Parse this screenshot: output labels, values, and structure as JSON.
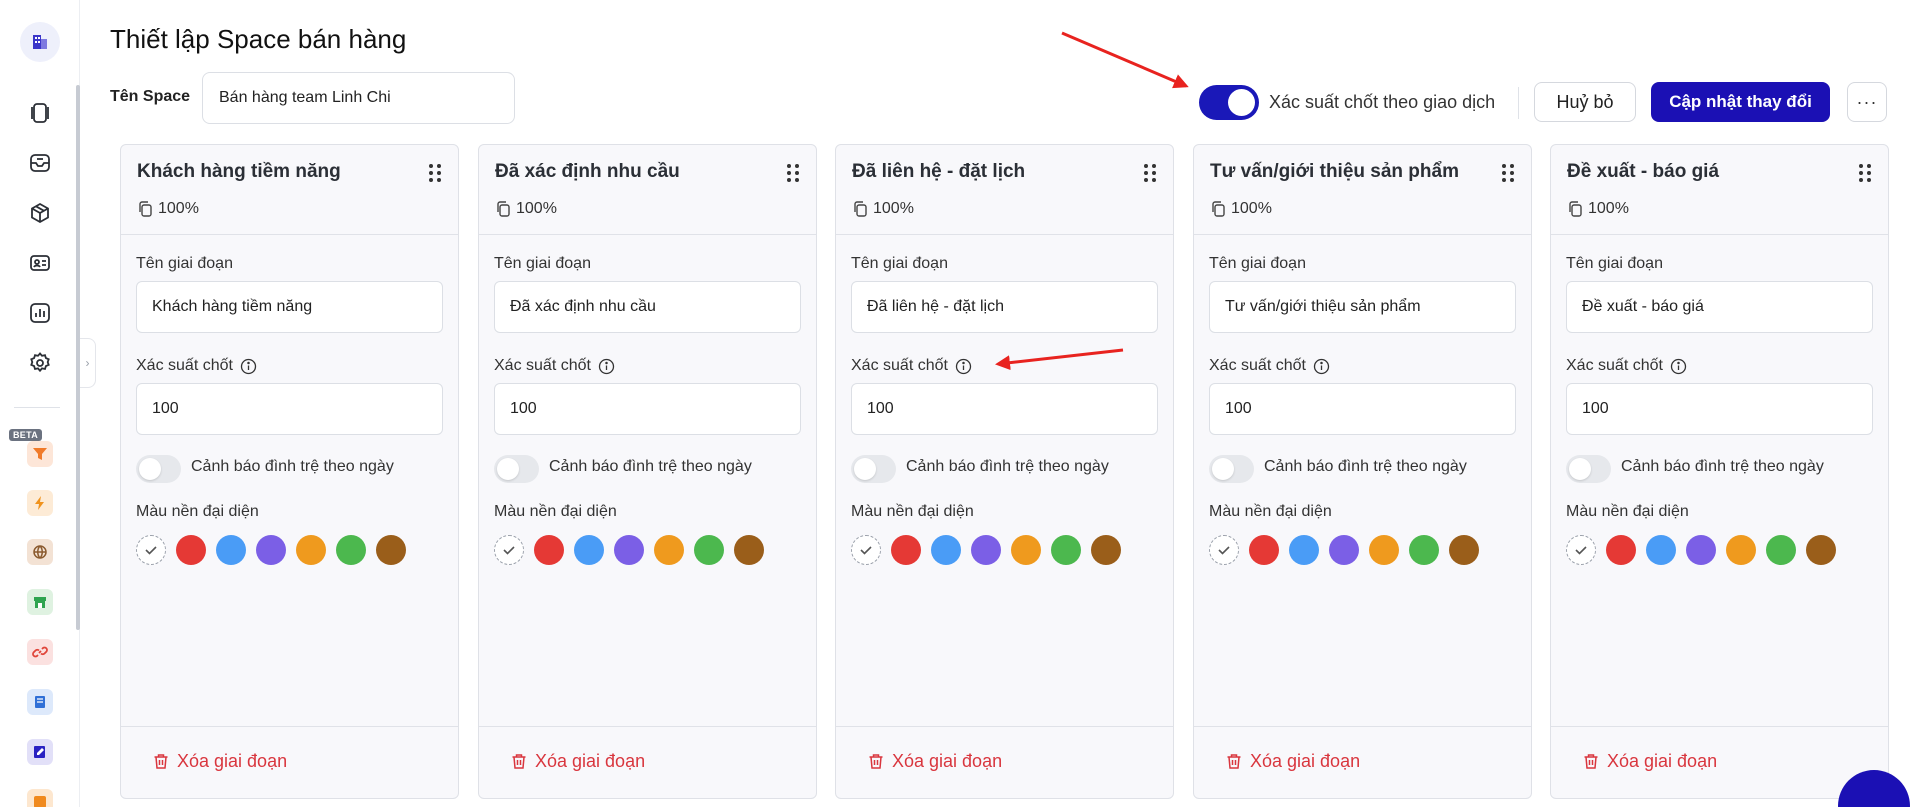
{
  "page": {
    "title": "Thiết lập Space bán hàng",
    "space_label": "Tên Space",
    "space_name": "Bán hàng team Linh Chi"
  },
  "header": {
    "toggle_label": "Xác suất chốt theo giao dịch",
    "toggle_on": true,
    "cancel_label": "Huỷ bỏ",
    "update_label": "Cập nhật thay đổi",
    "more_label": "···"
  },
  "sidebar": {
    "beta_label": "BETA",
    "collapse_glyph": "›"
  },
  "stage_field_labels": {
    "name": "Tên giai đoạn",
    "probability": "Xác suất chốt",
    "stagnation_warning": "Cảnh báo đình trệ theo ngày",
    "color": "Màu nền đại diện",
    "delete": "Xóa giai đoạn"
  },
  "swatch_colors": [
    "#e53935",
    "#4a9cf6",
    "#7b5fe6",
    "#ef9a1e",
    "#4cb84e",
    "#9a5e1a"
  ],
  "stages": [
    {
      "title": "Khách hàng tiềm năng",
      "percent": "100%",
      "name": "Khách hàng tiềm năng",
      "probability": "100",
      "stagnation_warning": false
    },
    {
      "title": "Đã xác định nhu cầu",
      "percent": "100%",
      "name": "Đã xác định nhu cầu",
      "probability": "100",
      "stagnation_warning": false
    },
    {
      "title": "Đã liên hệ - đặt lịch",
      "percent": "100%",
      "name": "Đã liên hệ - đặt lịch",
      "probability": "100",
      "stagnation_warning": false
    },
    {
      "title": "Tư vấn/giới thiệu sản phẩm",
      "percent": "100%",
      "name": "Tư vấn/giới thiệu sản phẩm",
      "probability": "100",
      "stagnation_warning": false
    },
    {
      "title": "Đề xuất - báo giá",
      "percent": "100%",
      "name": "Đề xuất - báo giá",
      "probability": "100",
      "stagnation_warning": false
    }
  ],
  "colors": {
    "primary": "#1b10b4",
    "danger": "#d9363e",
    "annotation_arrow": "#e8231f"
  }
}
